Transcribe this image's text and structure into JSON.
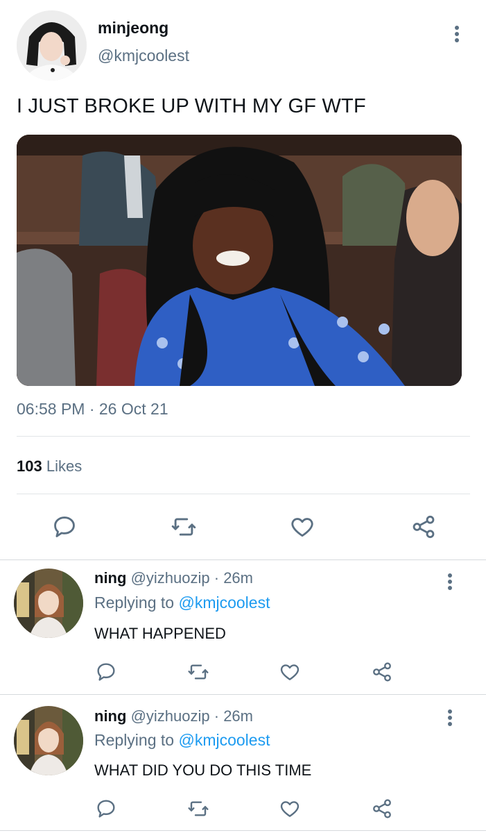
{
  "tweet": {
    "display_name": "minjeong",
    "handle": "@kmjcoolest",
    "text": "I JUST BROKE UP WITH MY GF WTF",
    "timestamp": "06:58 PM · 26 Oct 21",
    "likes_count": "103",
    "likes_label": "Likes",
    "actions": [
      "reply-icon",
      "retweet-icon",
      "like-icon",
      "share-icon"
    ],
    "menu_icon": "more-vertical-icon"
  },
  "replies": [
    {
      "display_name": "ning",
      "handle": "@yizhuozip",
      "time": "· 26m",
      "replying_prefix": "Replying to",
      "replying_to": "@kmjcoolest",
      "text": "WHAT HAPPENED"
    },
    {
      "display_name": "ning",
      "handle": "@yizhuozip",
      "time": "· 26m",
      "replying_prefix": "Replying to",
      "replying_to": "@kmjcoolest",
      "text": "WHAT DID YOU DO THIS TIME"
    }
  ],
  "colors": {
    "text": "#0f1419",
    "secondary": "#5b7083",
    "link": "#1d9bf0",
    "divider": "#e1e5e8"
  }
}
